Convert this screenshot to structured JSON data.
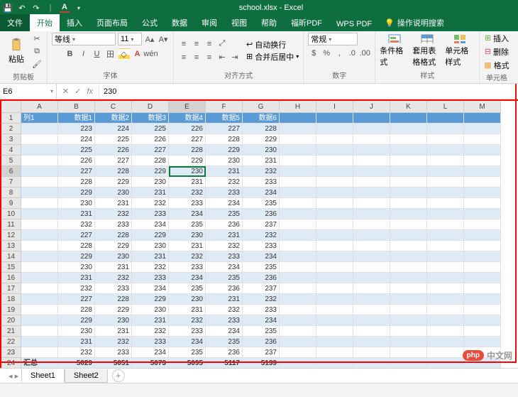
{
  "app": {
    "title": "school.xlsx - Excel"
  },
  "qat": {
    "save": "save",
    "undo": "undo",
    "redo": "redo"
  },
  "tabs": {
    "file": "文件",
    "home": "开始",
    "insert": "插入",
    "layout": "页面布局",
    "formulas": "公式",
    "data": "数据",
    "review": "审阅",
    "view": "视图",
    "help": "帮助",
    "foxit": "福昕PDF",
    "wps": "WPS PDF",
    "tell_me": "操作说明搜索"
  },
  "ribbon": {
    "clipboard": {
      "label": "剪贴板",
      "paste": "粘贴"
    },
    "font": {
      "label": "字体",
      "name": "等线",
      "size": "11"
    },
    "alignment": {
      "label": "对齐方式",
      "wrap": "自动换行",
      "merge": "合并后居中"
    },
    "number": {
      "label": "数字",
      "format": "常规"
    },
    "styles": {
      "label": "样式",
      "cond": "条件格式",
      "table": "套用表格格式",
      "cell": "单元格样式"
    },
    "cells": {
      "label": "单元格",
      "insert": "插入",
      "delete": "删除",
      "format": "格式"
    }
  },
  "formula_bar": {
    "name_box": "E6",
    "value": "230"
  },
  "columns": [
    "A",
    "B",
    "C",
    "D",
    "E",
    "F",
    "G",
    "H",
    "I",
    "J",
    "K",
    "L",
    "M"
  ],
  "header_row": [
    "列1",
    "数据1",
    "数据2",
    "数据3",
    "数据4",
    "数据5",
    "数据6"
  ],
  "rows": [
    [
      "",
      "223",
      "224",
      "225",
      "226",
      "227",
      "228"
    ],
    [
      "",
      "224",
      "225",
      "226",
      "227",
      "228",
      "229"
    ],
    [
      "",
      "225",
      "226",
      "227",
      "228",
      "229",
      "230"
    ],
    [
      "",
      "226",
      "227",
      "228",
      "229",
      "230",
      "231"
    ],
    [
      "",
      "227",
      "228",
      "229",
      "230",
      "231",
      "232"
    ],
    [
      "",
      "228",
      "229",
      "230",
      "231",
      "232",
      "233"
    ],
    [
      "",
      "229",
      "230",
      "231",
      "232",
      "233",
      "234"
    ],
    [
      "",
      "230",
      "231",
      "232",
      "233",
      "234",
      "235"
    ],
    [
      "",
      "231",
      "232",
      "233",
      "234",
      "235",
      "236"
    ],
    [
      "",
      "232",
      "233",
      "234",
      "235",
      "236",
      "237"
    ],
    [
      "",
      "227",
      "228",
      "229",
      "230",
      "231",
      "232"
    ],
    [
      "",
      "228",
      "229",
      "230",
      "231",
      "232",
      "233"
    ],
    [
      "",
      "229",
      "230",
      "231",
      "232",
      "233",
      "234"
    ],
    [
      "",
      "230",
      "231",
      "232",
      "233",
      "234",
      "235"
    ],
    [
      "",
      "231",
      "232",
      "233",
      "234",
      "235",
      "236"
    ],
    [
      "",
      "232",
      "233",
      "234",
      "235",
      "236",
      "237"
    ],
    [
      "",
      "227",
      "228",
      "229",
      "230",
      "231",
      "232"
    ],
    [
      "",
      "228",
      "229",
      "230",
      "231",
      "232",
      "233"
    ],
    [
      "",
      "229",
      "230",
      "231",
      "232",
      "233",
      "234"
    ],
    [
      "",
      "230",
      "231",
      "232",
      "233",
      "234",
      "235"
    ],
    [
      "",
      "231",
      "232",
      "233",
      "234",
      "235",
      "236"
    ]
  ],
  "summary_row": [
    "汇总",
    "5029",
    "5051",
    "5073",
    "5095",
    "5117",
    "5139"
  ],
  "sheets": {
    "s1": "Sheet1",
    "s2": "Sheet2"
  },
  "active_cell": {
    "row": 6,
    "col": 5
  },
  "watermark": {
    "badge": "php",
    "text": "中文网"
  }
}
